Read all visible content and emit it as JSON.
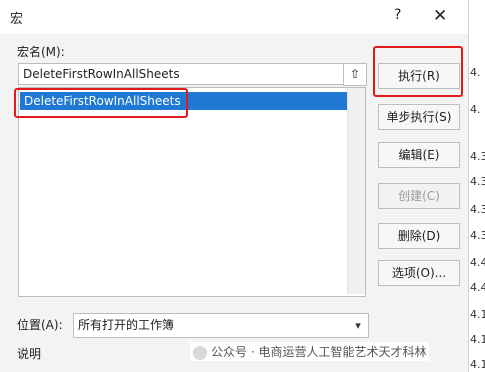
{
  "window": {
    "title": "宏",
    "help_label": "?",
    "close_label": "✕"
  },
  "form": {
    "macro_name_label": "宏名(M):",
    "macro_name_value": "DeleteFirstRowInAllSheets",
    "list": [
      "DeleteFirstRowInAllSheets"
    ],
    "location_label": "位置(A):",
    "location_value": "所有打开的工作簿",
    "description_label": "说明"
  },
  "buttons": {
    "run": "执行(R)",
    "step": "单步执行(S)",
    "edit": "编辑(E)",
    "create": "创建(C)",
    "delete": "删除(D)",
    "options": "选项(O)..."
  },
  "sheet_values": [
    "4.",
    "4.",
    "4.3",
    "4.3",
    "4.3",
    "4.3",
    "4.4",
    "4.4",
    "4.1",
    "4.1",
    "4.1"
  ],
  "watermark": "公众号 · 电商运营人工智能艺术天才科林",
  "colors": {
    "selection": "#1e78d4",
    "highlight": "#e11b1b"
  }
}
